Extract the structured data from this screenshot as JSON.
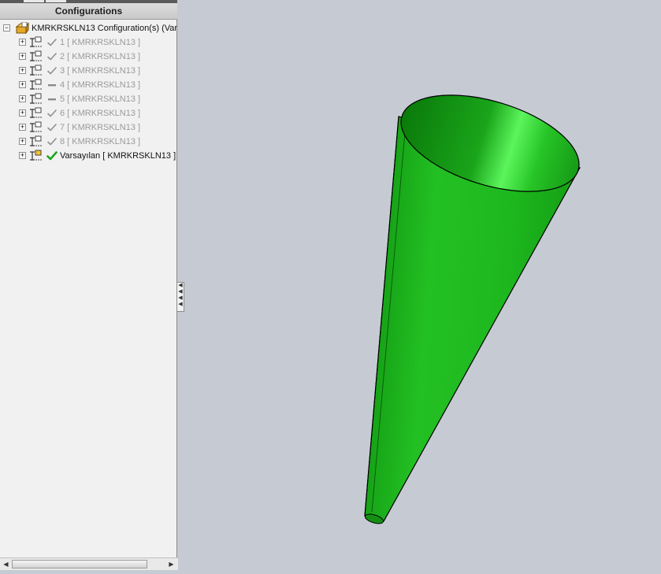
{
  "panel": {
    "header_title": "Configurations",
    "root_label": "KMRKRSKLN13 Configuration(s)  (Varsa"
  },
  "configurations": [
    {
      "label": "1 [ KMRKRSKLN13 ]",
      "state": "check-icon",
      "active": false
    },
    {
      "label": "2 [ KMRKRSKLN13 ]",
      "state": "check-icon",
      "active": false
    },
    {
      "label": "3 [ KMRKRSKLN13 ]",
      "state": "check-icon",
      "active": false
    },
    {
      "label": "4 [ KMRKRSKLN13 ]",
      "state": "dash-icon",
      "active": false
    },
    {
      "label": "5 [ KMRKRSKLN13 ]",
      "state": "dash-icon",
      "active": false
    },
    {
      "label": "6 [ KMRKRSKLN13 ]",
      "state": "check-icon",
      "active": false
    },
    {
      "label": "7 [ KMRKRSKLN13 ]",
      "state": "check-icon",
      "active": false
    },
    {
      "label": "8 [ KMRKRSKLN13 ]",
      "state": "check-icon",
      "active": false
    },
    {
      "label": "Varsayılan [ KMRKRSKLN13 ]",
      "state": "green-check-icon",
      "active": true
    }
  ],
  "model": {
    "shape": "cone",
    "color": "#1fc21f"
  }
}
